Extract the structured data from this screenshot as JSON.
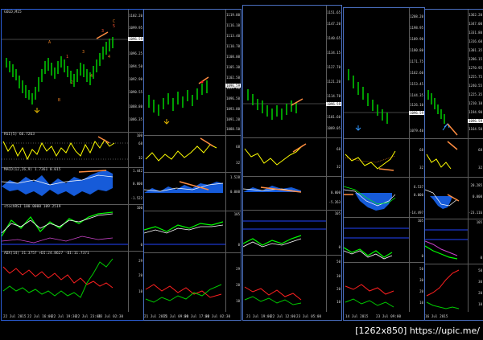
{
  "watermark": "[1262x850] https://upic.me/",
  "colors": {
    "candle_up": "#00d000",
    "macd_hist": "#1a6bff",
    "rsi": "#ffff00",
    "stoch": "#ffffff",
    "adx_plus": "#00cc00",
    "adx_minus": "#ff2020",
    "arrow": "#ff8c40"
  },
  "windows": [
    {
      "title": "GOLD,M15",
      "price_ticks": [
        "1102.20",
        "1099.95",
        "1096.25",
        "1094.50",
        "1092.90",
        "1090.55",
        "1088.80",
        "1086.35"
      ],
      "price_box": "1096.59",
      "wave_labels": [
        "A",
        "B",
        "1",
        "2",
        "3",
        "4",
        "5",
        "C",
        "4",
        "3"
      ],
      "rsi_label": "RSI(5) 66.7263",
      "rsi_ticks": [
        "100",
        "68",
        "32",
        "0"
      ],
      "macd_label": "MACD(12,26,9) 1.7361 0.015",
      "macd_ticks": [
        "1.442",
        "0.000",
        "-1.522"
      ],
      "stoch_label": "stochRSI 100.0000 109.2519",
      "stoch_ticks": [
        "100",
        "0"
      ],
      "adx_label": "ADX(14) 31.3757 +DI:24.8627 -DI:11.7371",
      "adx_ticks": [
        "29",
        "20",
        "10"
      ],
      "time_labels": [
        "22 Jul 2015",
        "22 Jul 16:00",
        "22 Jul 19:30",
        "22 Jul 23:00",
        "23 Jul 02:30",
        "23 Jul 04:00"
      ]
    },
    {
      "price_ticks": [
        "1119.00",
        "1116.10",
        "1113.40",
        "1110.70",
        "1108.00",
        "1105.30",
        "1102.50",
        "1099.80",
        "1096.50",
        "1093.80",
        "1091.20",
        "1088.50"
      ],
      "price_box": "1096.59",
      "rsi_ticks": [
        "68",
        "32"
      ],
      "macd_ticks": [
        "1.528",
        "0.000"
      ],
      "stoch_ticks": [
        "105",
        "0"
      ],
      "adx_ticks": [
        "29",
        "20",
        "10"
      ],
      "time_labels": [
        "21 Jul 2015",
        "21 Jul 09:00",
        "21 Jul 17:00",
        "22 Jul 02:30"
      ]
    },
    {
      "price_ticks": [
        "1151.65",
        "1147.20",
        "1140.65",
        "1134.15",
        "1127.70",
        "1121.20",
        "1114.70",
        "1108.15",
        "1101.60",
        "1096.59",
        "1089.05"
      ],
      "price_box": "1096.59",
      "rsi_ticks": [
        "68",
        "32"
      ],
      "macd_ticks": [
        "-5.263",
        "0.000"
      ],
      "stoch_ticks": [
        "105",
        "0"
      ],
      "adx_ticks": [
        "50",
        "30",
        "20",
        "10"
      ],
      "time_labels": [
        "21 Jul 19:00",
        "22 Jul 12:00",
        "23 Jul 05:00"
      ]
    },
    {
      "price_ticks": [
        "1208.20",
        "1198.95",
        "1189.90",
        "1180.80",
        "1171.75",
        "1162.60",
        "1153.45",
        "1144.35",
        "1135.20",
        "1126.10",
        "1096.59",
        "1079.40"
      ],
      "price_box": "1096.59",
      "rsi_ticks": [
        "68",
        "32"
      ],
      "macd_ticks": [
        "6.537",
        "0.000",
        "-14.497"
      ],
      "stoch_ticks": [
        "105",
        "0"
      ],
      "adx_ticks": [
        "50",
        "30",
        "20",
        "10"
      ],
      "time_labels": [
        "14 Jul 2015",
        "23 Jul 09:00"
      ]
    },
    {
      "price_ticks": [
        "1362.20",
        "1347.00",
        "1331.80",
        "1316.60",
        "1301.35",
        "1286.15",
        "1270.95",
        "1255.75",
        "1240.55",
        "1225.35",
        "1210.10",
        "1194.90",
        "1179.70",
        "1164.50"
      ],
      "price_box": "1096.59",
      "rsi_ticks": [
        "68",
        "32"
      ],
      "macd_ticks": [
        "20.285",
        "0.000",
        "-23.116"
      ],
      "stoch_ticks": [
        "105",
        "0"
      ],
      "adx_ticks": [
        "50",
        "30",
        "20",
        "10"
      ],
      "time_labels": [
        "14 Jul 2015",
        "16 Jul 2015"
      ]
    }
  ]
}
